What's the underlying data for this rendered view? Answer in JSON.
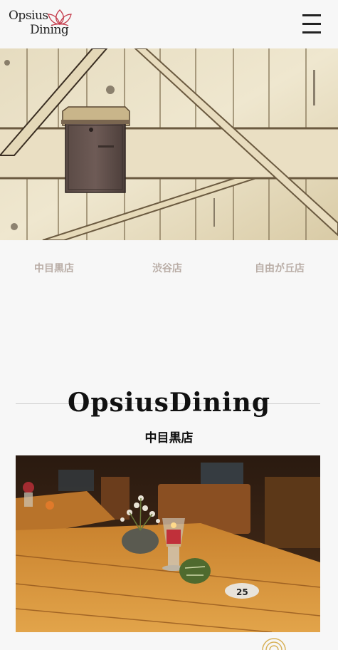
{
  "header": {
    "logo_line1": "Opsius",
    "logo_line2": "Dining",
    "menu_icon": "hamburger-menu-icon"
  },
  "hero": {
    "icon": "mailbox-on-wooden-door-photo"
  },
  "tabs": [
    {
      "label": "中目黒店"
    },
    {
      "label": "渋谷店"
    },
    {
      "label": "自由が丘店"
    }
  ],
  "section": {
    "title": "OpsiusDining",
    "subtitle": "中目黒店"
  },
  "photo": {
    "icon": "restaurant-table-photo",
    "table_number": "25"
  },
  "colors": {
    "background": "#f7f7f7",
    "tab_text": "#b9ada6",
    "logo_accent": "#c43a4a",
    "badge_accent": "#d8b25a"
  }
}
